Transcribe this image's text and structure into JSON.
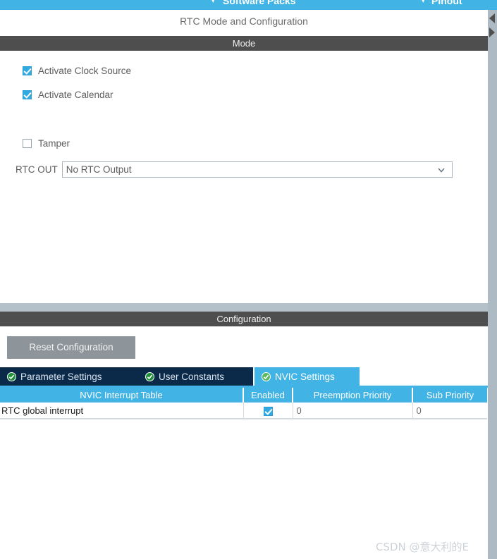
{
  "topbar": {
    "items": [
      {
        "label": "Software Packs",
        "icon": "chevron-down-icon"
      },
      {
        "label": "Pinout",
        "icon": "chevron-down-icon"
      }
    ],
    "accent_color": "#42b3e5"
  },
  "pane_arrows": {
    "left_icon": "arrow-left-icon",
    "right_icon": "arrow-right-icon"
  },
  "mode_panel": {
    "title": "RTC Mode and Configuration",
    "section_header": "Mode",
    "checkboxes": [
      {
        "label": "Activate Clock Source",
        "checked": true
      },
      {
        "label": "Activate Calendar",
        "checked": true
      },
      {
        "label": "Tamper",
        "checked": false
      }
    ],
    "rtc_out": {
      "label": "RTC OUT",
      "value": "No RTC Output",
      "arrow_icon": "chevron-down-icon"
    }
  },
  "config_panel": {
    "section_header": "Configuration",
    "reset_button": "Reset Configuration",
    "tabs": [
      {
        "label": "Parameter Settings",
        "icon": "check-circle-icon",
        "active": false
      },
      {
        "label": "User Constants",
        "icon": "check-circle-icon",
        "active": false
      },
      {
        "label": "NVIC Settings",
        "icon": "check-circle-icon",
        "active": true
      }
    ],
    "nvic_table": {
      "columns": [
        "NVIC Interrupt Table",
        "Enabled",
        "Preemption Priority",
        "Sub Priority"
      ],
      "rows": [
        {
          "name": "RTC global interrupt",
          "enabled": true,
          "preemption_priority": "0",
          "sub_priority": "0"
        }
      ]
    }
  },
  "watermark": "CSDN @意大利的E",
  "colors": {
    "accent_blue": "#42b3e5",
    "header_dark": "#4e4e4e",
    "tab_inactive": "#0b2a4a",
    "splitter": "#b5c1c9",
    "button_gray": "#8d949a",
    "scrollbar": "#adbac3"
  }
}
